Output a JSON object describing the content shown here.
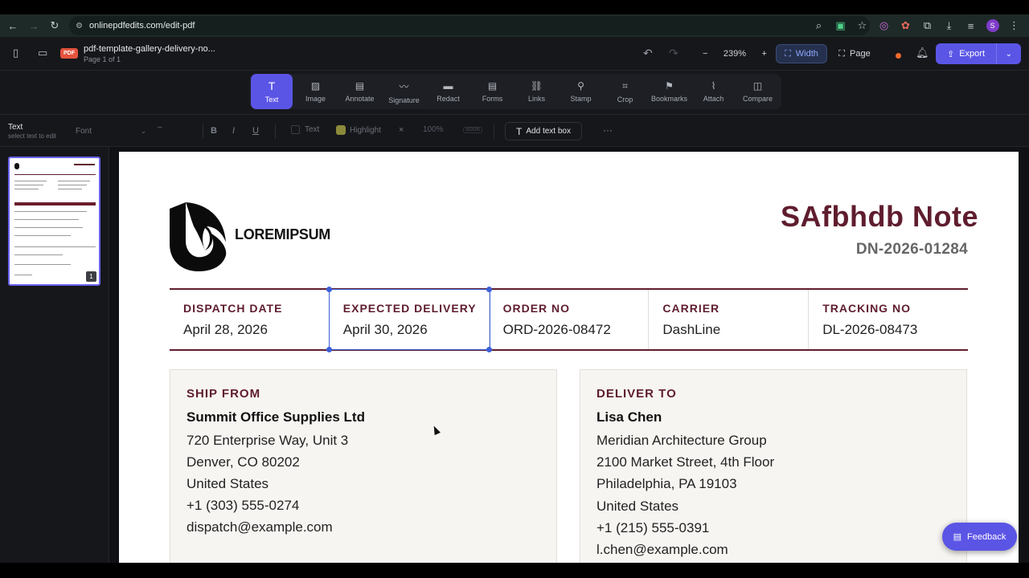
{
  "browser": {
    "url": "onlinepdfedits.com/edit-pdf",
    "avatar_letter": "S"
  },
  "app": {
    "file_badge": "PDF",
    "doc_title": "pdf-template-gallery-delivery-no...",
    "doc_subtitle": "Page 1 of 1",
    "zoom_minus": "−",
    "zoom_level": "239%",
    "zoom_plus": "+",
    "width_label": "Width",
    "page_label": "Page",
    "export_label": "Export",
    "accent_color": "#5b55e6"
  },
  "tools": [
    {
      "label": "Text",
      "icon": "text-icon"
    },
    {
      "label": "Image",
      "icon": "image-icon"
    },
    {
      "label": "Annotate",
      "icon": "annotate-icon"
    },
    {
      "label": "Signature",
      "icon": "signature-icon"
    },
    {
      "label": "Redact",
      "icon": "redact-icon"
    },
    {
      "label": "Forms",
      "icon": "forms-icon"
    },
    {
      "label": "Links",
      "icon": "link-icon"
    },
    {
      "label": "Stamp",
      "icon": "stamp-icon"
    },
    {
      "label": "Crop",
      "icon": "crop-icon"
    },
    {
      "label": "Bookmarks",
      "icon": "bookmark-icon"
    },
    {
      "label": "Attach",
      "icon": "attach-icon"
    },
    {
      "label": "Compare",
      "icon": "compare-icon"
    }
  ],
  "format": {
    "mode_title": "Text",
    "mode_hint": "select text to edit",
    "font_placeholder": "Font",
    "size_value": "–",
    "bold": "B",
    "italic": "I",
    "underline": "U",
    "text_color_label": "Text",
    "highlight_label": "Highlight",
    "clear": "×",
    "opacity": "100%",
    "soon": "SOON",
    "add_text_box": "Add text box",
    "more": "···"
  },
  "sidebar": {
    "page_number": "1"
  },
  "document": {
    "logo_text": "LOREMIPSUM",
    "heading": "SAfbhdb Note",
    "number": "DN-2026-01284",
    "brand_color": "#5f1d2e",
    "meta": [
      {
        "label": "DISPATCH DATE",
        "value": "April 28, 2026"
      },
      {
        "label": "EXPECTED DELIVERY",
        "value": "April 30, 2026"
      },
      {
        "label": "ORDER NO",
        "value": "ORD-2026-08472"
      },
      {
        "label": "CARRIER",
        "value": "DashLine"
      },
      {
        "label": "TRACKING NO",
        "value": "DL-2026-08473"
      }
    ],
    "ship_from": {
      "label": "SHIP FROM",
      "name": "Summit Office Supplies Ltd",
      "lines": [
        "720 Enterprise Way, Unit 3",
        "Denver, CO 80202",
        "United States",
        "+1 (303) 555-0274",
        "dispatch@example.com"
      ]
    },
    "deliver_to": {
      "label": "DELIVER TO",
      "name": "Lisa Chen",
      "lines": [
        "Meridian Architecture Group",
        "2100 Market Street, 4th Floor",
        "Philadelphia, PA 19103",
        "United States",
        "+1 (215) 555-0391",
        "l.chen@example.com"
      ]
    }
  },
  "feedback_label": "Feedback"
}
